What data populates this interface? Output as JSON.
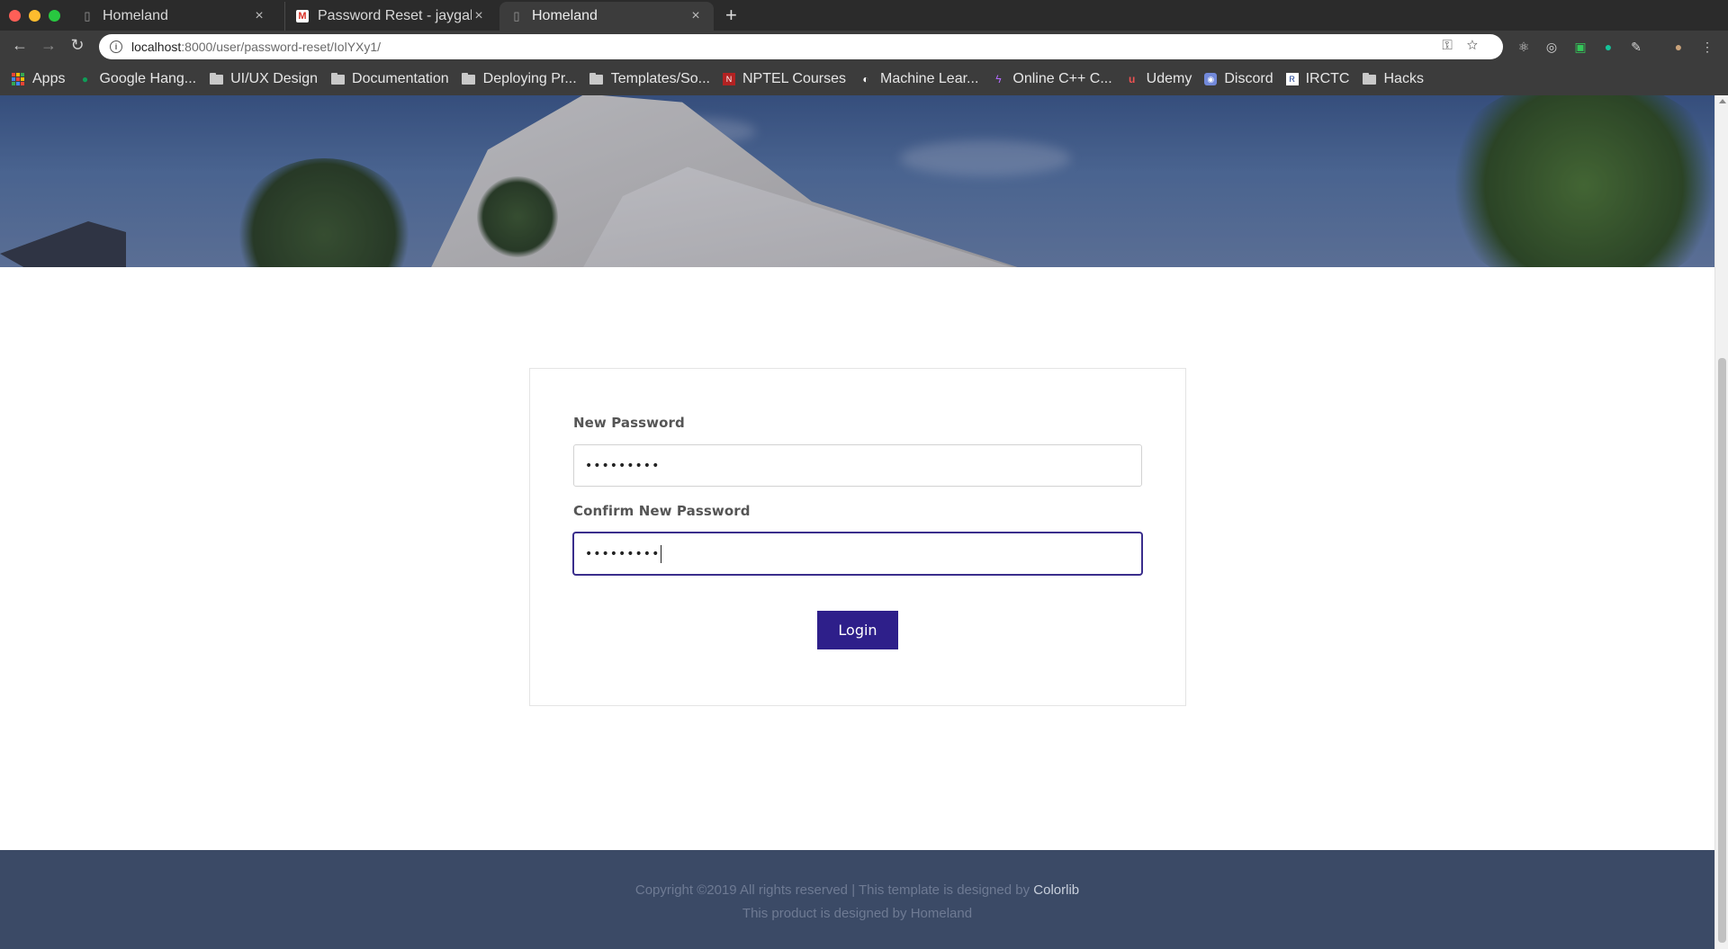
{
  "browser": {
    "tabs": [
      {
        "title": "Homeland",
        "active": false
      },
      {
        "title": "Password Reset - jaygala",
        "active": false
      },
      {
        "title": "Homeland",
        "active": true
      }
    ],
    "new_tab_symbol": "+",
    "url_host": "localhost",
    "url_path": ":8000/user/password-reset/IolYXy1/",
    "bookmarks": [
      {
        "label": "Apps",
        "icon": "apps-grid-icon"
      },
      {
        "label": "Google Hang...",
        "icon": "hangouts-icon"
      },
      {
        "label": "UI/UX Design",
        "icon": "folder-icon"
      },
      {
        "label": "Documentation",
        "icon": "folder-icon"
      },
      {
        "label": "Deploying Pr...",
        "icon": "folder-icon"
      },
      {
        "label": "Templates/So...",
        "icon": "folder-icon"
      },
      {
        "label": "NPTEL Courses",
        "icon": "nptel-icon"
      },
      {
        "label": "Machine Lear...",
        "icon": "ml-icon"
      },
      {
        "label": "Online C++ C...",
        "icon": "bolt-icon"
      },
      {
        "label": "Udemy",
        "icon": "udemy-icon"
      },
      {
        "label": "Discord",
        "icon": "discord-icon"
      },
      {
        "label": "IRCTC",
        "icon": "irctc-icon"
      },
      {
        "label": "Hacks",
        "icon": "folder-icon"
      }
    ]
  },
  "form": {
    "new_password_label": "New Password",
    "new_password_value": "•••••••••",
    "confirm_password_label": "Confirm New Password",
    "confirm_password_value": "•••••••••",
    "submit_label": "Login"
  },
  "footer": {
    "copyright_text": "Copyright ©2019 All rights reserved | This template is designed by ",
    "copyright_brand": "Colorlib",
    "product_text": "This product is designed by Homeland"
  },
  "colors": {
    "accent": "#2e1f8a",
    "footer_bg": "#3b4a66",
    "focus_border": "#3a2e8c"
  }
}
